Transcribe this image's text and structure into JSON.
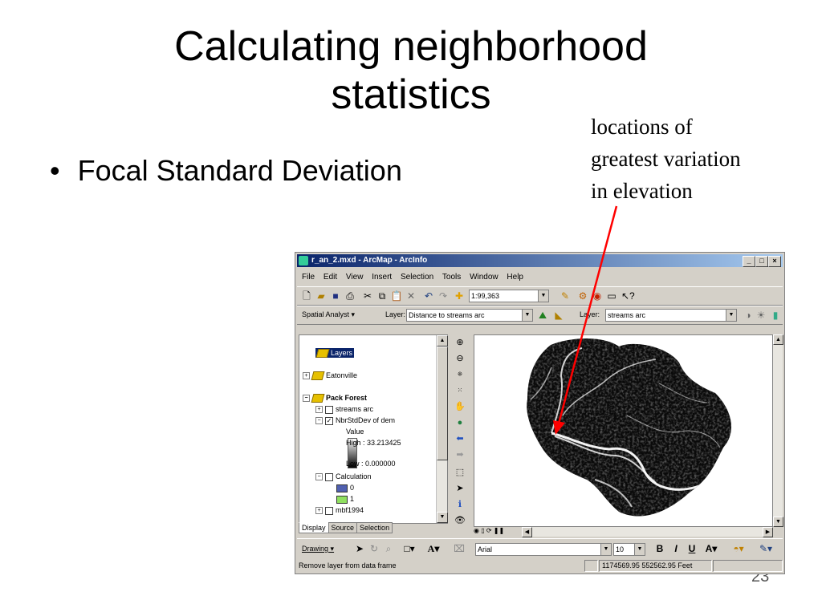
{
  "slide": {
    "title_line1": "Calculating neighborhood",
    "title_line2": "statistics",
    "bullet": "Focal Standard Deviation",
    "annotation_line1": "locations of",
    "annotation_line2": "greatest variation",
    "annotation_line3": "in elevation",
    "slide_number": "23",
    "arrow_color": "#ff0000"
  },
  "window": {
    "title": "r_an_2.mxd - ArcMap - ArcInfo",
    "controls": [
      "_",
      "□",
      "×"
    ],
    "menu": [
      "File",
      "Edit",
      "View",
      "Insert",
      "Selection",
      "Tools",
      "Window",
      "Help"
    ]
  },
  "toolbar1": {
    "scale": "1:99,363",
    "icons": [
      "new-icon",
      "open-icon",
      "save-icon",
      "print-icon",
      "cut-icon",
      "copy-icon",
      "paste-icon",
      "delete-icon",
      "undo-icon",
      "redo-icon",
      "add-data-icon",
      "editor-icon",
      "arctoolbox-icon",
      "catalog-icon",
      "window-icon",
      "whats-this-icon"
    ]
  },
  "toolbar2": {
    "spatial_analyst": "Spatial Analyst",
    "layer_label": "Layer:",
    "layer_value": "Distance to streams arc",
    "layer2_label": "Layer:",
    "layer2_value": "streams arc"
  },
  "toc": {
    "items": [
      {
        "label": "Layers"
      },
      {
        "label": "Eatonville"
      },
      {
        "label": "Pack Forest"
      },
      {
        "label": "streams arc"
      },
      {
        "label": "NbrStdDev of dem"
      },
      {
        "label": "Value"
      },
      {
        "label": "High : 33.213425"
      },
      {
        "label": "Low : 0.000000"
      },
      {
        "label": "Calculation"
      },
      {
        "label": "0"
      },
      {
        "label": "1"
      },
      {
        "label": "mbf1994"
      }
    ],
    "swatch_colors": [
      "#5060b0",
      "#90e060"
    ],
    "tabs": [
      "Display",
      "Source",
      "Selection"
    ]
  },
  "drawing_toolbar": {
    "drawing": "Drawing",
    "font": "Arial",
    "size": "10",
    "bold": "B",
    "italic": "I",
    "underline": "U",
    "text_tool": "A"
  },
  "status": {
    "message": "Remove layer from data frame",
    "coords": "1174569.95  552562.95 Feet"
  }
}
